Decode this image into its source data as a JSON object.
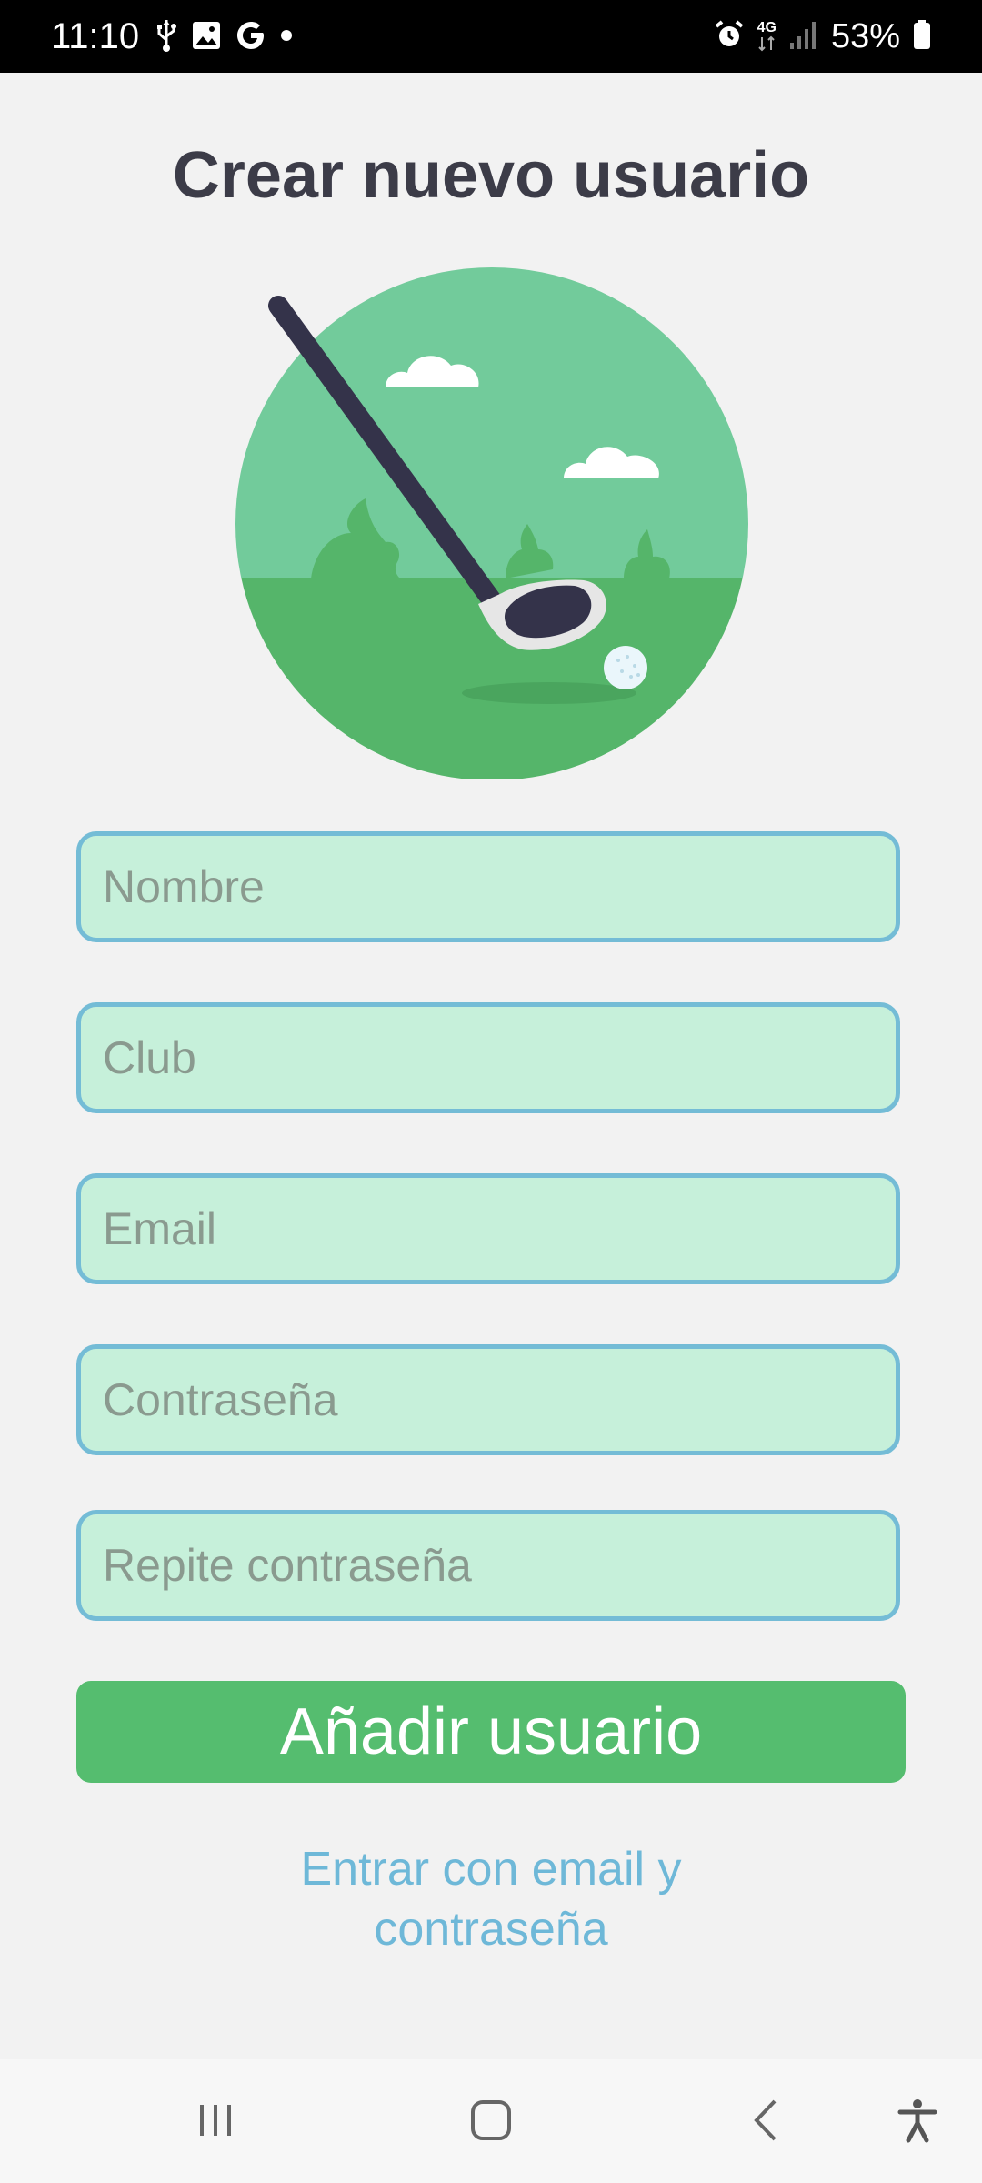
{
  "status_bar": {
    "time": "11:10",
    "network": "4G",
    "battery": "53%",
    "left_icons": [
      "usb-icon",
      "image-icon",
      "google-icon",
      "dot-icon"
    ],
    "right_icons": [
      "alarm-icon",
      "signal-icon",
      "battery-icon"
    ]
  },
  "page": {
    "title": "Crear nuevo usuario"
  },
  "hero": {
    "icon": "golf-club-illustration",
    "colors": {
      "sky": "#72cb9b",
      "grass": "#55b56a",
      "club_shaft": "#34334a",
      "cloud": "#ffffff"
    }
  },
  "form": {
    "fields": [
      {
        "name": "nombre",
        "placeholder": "Nombre",
        "value": ""
      },
      {
        "name": "club",
        "placeholder": "Club",
        "value": ""
      },
      {
        "name": "email",
        "placeholder": "Email",
        "value": ""
      },
      {
        "name": "password",
        "placeholder": "Contraseña",
        "value": ""
      },
      {
        "name": "repeat_password",
        "placeholder": "Repite contraseña",
        "value": ""
      }
    ],
    "submit_label": "Añadir usuario",
    "login_link": "Entrar con email y contraseña"
  },
  "colors": {
    "field_bg": "#c6f0da",
    "field_border": "#74bcd6",
    "primary": "#55bd6f",
    "link": "#6eb8d8",
    "title": "#3c3c48"
  },
  "nav_bar": {
    "buttons": [
      "recent-apps-icon",
      "home-icon",
      "back-icon",
      "accessibility-icon"
    ]
  }
}
